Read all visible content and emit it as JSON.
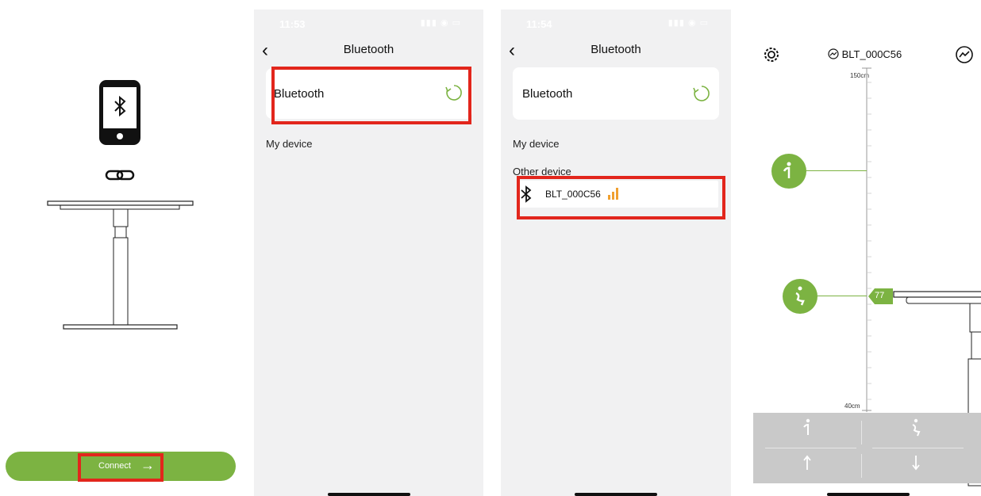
{
  "panel1": {
    "connect_label": "Connect",
    "arrow_glyph": "→"
  },
  "panel2": {
    "time": "11:53",
    "title": "Bluetooth",
    "bluetooth_label": "Bluetooth",
    "my_device": "My device"
  },
  "panel3": {
    "time": "11:54",
    "title": "Bluetooth",
    "bluetooth_label": "Bluetooth",
    "my_device": "My device",
    "other_device": "Other device",
    "device_name": "BLT_000C56"
  },
  "panel4": {
    "device_name": "BLT_000C56",
    "scale_top": "150cm",
    "scale_bottom": "40cm",
    "current_height": "77",
    "colors": {
      "accent": "#7cb342",
      "highlight": "#e2261c",
      "signal": "#f0a030"
    }
  },
  "icons": {
    "back": "chevron-left-icon",
    "refresh": "refresh-icon",
    "bluetooth": "bluetooth-icon",
    "signal": "signal-bars-icon",
    "settings": "gear-icon",
    "stats": "chart-icon"
  }
}
